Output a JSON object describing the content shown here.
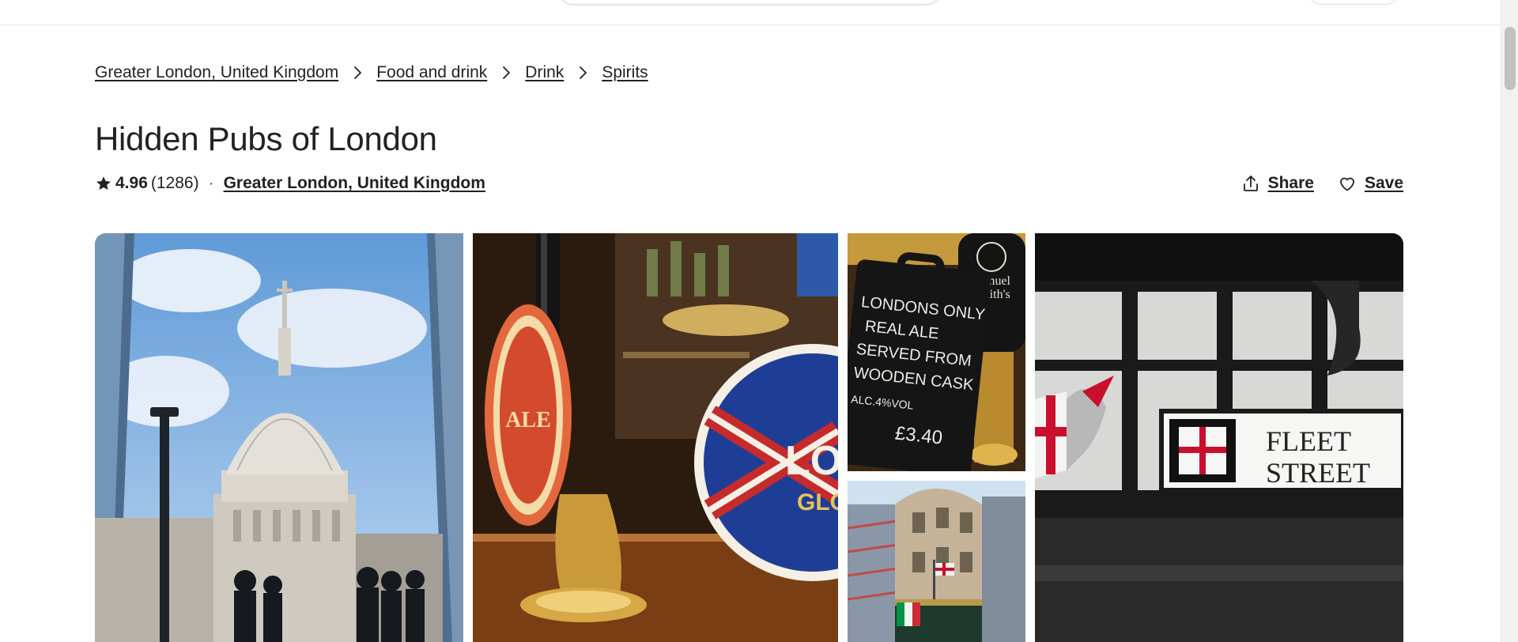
{
  "breadcrumb": {
    "items": [
      {
        "label": "Greater London, United Kingdom"
      },
      {
        "label": "Food and drink"
      },
      {
        "label": "Drink"
      },
      {
        "label": "Spirits"
      }
    ]
  },
  "listing": {
    "title": "Hidden Pubs of London",
    "rating": "4.96",
    "reviews": "(1286)",
    "separator": "·",
    "location": "Greater London, United Kingdom"
  },
  "actions": {
    "share_label": "Share",
    "save_label": "Save"
  },
  "icons": {
    "rating": "star-icon",
    "share": "share-icon",
    "save": "heart-icon",
    "breadcrumb_separator": "chevron-right-icon"
  },
  "gallery": {
    "photos": [
      {
        "subject": "cathedral-dome"
      },
      {
        "subject": "beer-pump-taps"
      },
      {
        "subject": "chalkboard-sign",
        "text_lines": [
          "LONDONS ONLY",
          "REAL ALE",
          "SERVED FROM",
          "WOODEN CASK",
          "ALC.4%VOL",
          "£3.40"
        ]
      },
      {
        "subject": "pub-building"
      },
      {
        "subject": "street-sign",
        "text_lines": [
          "FLEET",
          "STREET"
        ]
      }
    ]
  },
  "colors": {
    "text": "#222222",
    "border": "#dddddd",
    "divider": "#ebebeb"
  }
}
